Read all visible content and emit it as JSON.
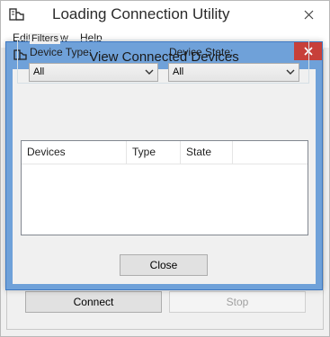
{
  "outer_window": {
    "title": "Loading Connection Utility",
    "menu": [
      "Edit",
      "View",
      "Help"
    ],
    "buttons": {
      "connect": "Connect",
      "stop": "Stop"
    }
  },
  "dialog": {
    "title": "View Connected Devices",
    "filters": {
      "legend": "Filters",
      "device_type": {
        "label": "Device Type:",
        "value": "All"
      },
      "device_state": {
        "label": "Device State:",
        "value": "All"
      }
    },
    "devices_table": {
      "columns": [
        "Devices",
        "Type",
        "State"
      ],
      "rows": []
    },
    "close_button": "Close"
  },
  "colors": {
    "dialog_frame": "#6fa1d9",
    "close_button_red": "#c7403a",
    "window_background": "#f0f0f0"
  },
  "icons": {
    "app_icon": "connection-utility-icon",
    "close": "close-icon",
    "dropdown": "chevron-down-icon"
  }
}
